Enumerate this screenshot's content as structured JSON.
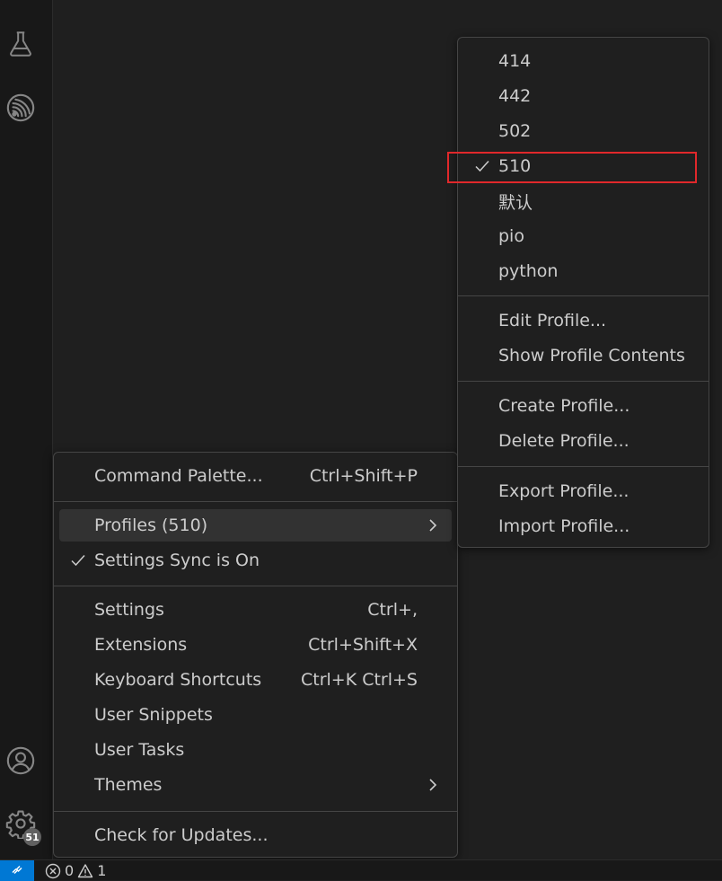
{
  "activity_bar": {
    "icons": [
      "testing-flask-icon",
      "espressif-icon",
      "accounts-icon",
      "manage-gear-icon"
    ],
    "manage_badge": "51"
  },
  "manage_menu": {
    "items": [
      {
        "label": "Command Palette...",
        "shortcut": "Ctrl+Shift+P"
      },
      {
        "label": "Profiles (510)",
        "submenu": true,
        "hover": true
      },
      {
        "label": "Settings Sync is On",
        "checked": true
      },
      {
        "label": "Settings",
        "shortcut": "Ctrl+,"
      },
      {
        "label": "Extensions",
        "shortcut": "Ctrl+Shift+X"
      },
      {
        "label": "Keyboard Shortcuts",
        "shortcut": "Ctrl+K Ctrl+S"
      },
      {
        "label": "User Snippets"
      },
      {
        "label": "User Tasks"
      },
      {
        "label": "Themes",
        "submenu": true
      },
      {
        "label": "Check for Updates..."
      }
    ]
  },
  "profiles_menu": {
    "profiles": [
      "414",
      "442",
      "502",
      "510",
      "默认",
      "pio",
      "python"
    ],
    "active_profile": "510",
    "actions": [
      "Edit Profile...",
      "Show Profile Contents",
      "Create Profile...",
      "Delete Profile...",
      "Export Profile...",
      "Import Profile..."
    ]
  },
  "status_bar": {
    "errors": "0",
    "warnings": "1"
  },
  "colors": {
    "accent": "#0078d4",
    "highlight_box": "#e0282b"
  }
}
